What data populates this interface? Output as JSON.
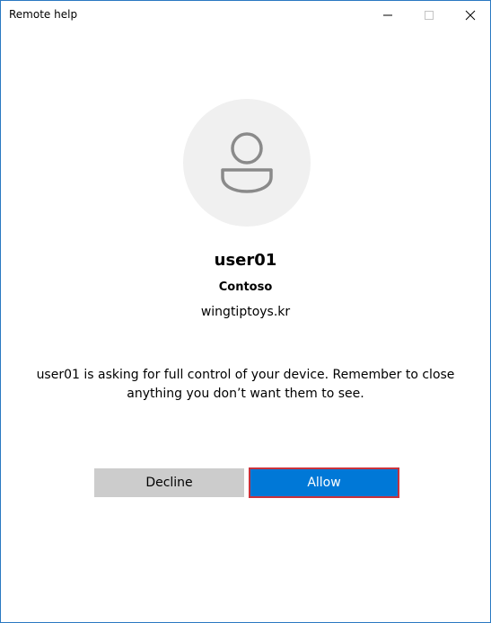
{
  "window": {
    "title": "Remote help"
  },
  "requester": {
    "name": "user01",
    "organization": "Contoso",
    "domain": "wingtiptoys.kr"
  },
  "message": "user01 is asking for full control of your device. Remember to close anything you don’t want them to see.",
  "actions": {
    "decline_label": "Decline",
    "allow_label": "Allow"
  },
  "colors": {
    "accent": "#0078d7",
    "decline_bg": "#cccccc",
    "avatar_bg": "#f0f0f0",
    "focus_outline": "#c8323c"
  },
  "icons": {
    "avatar": "person-icon",
    "minimize": "minimize-icon",
    "maximize": "maximize-icon",
    "close": "close-icon"
  }
}
